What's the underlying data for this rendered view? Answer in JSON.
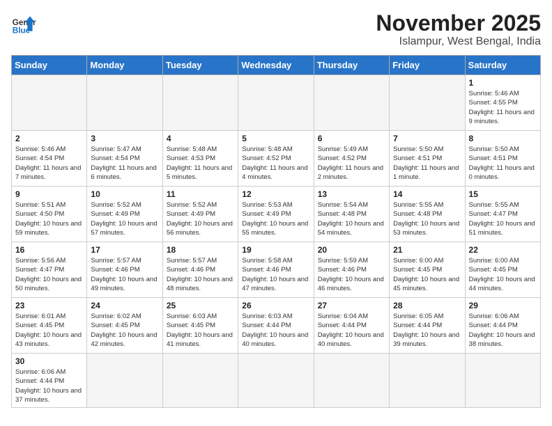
{
  "header": {
    "logo_line1": "General",
    "logo_line2": "Blue",
    "month": "November 2025",
    "location": "Islampur, West Bengal, India"
  },
  "days_of_week": [
    "Sunday",
    "Monday",
    "Tuesday",
    "Wednesday",
    "Thursday",
    "Friday",
    "Saturday"
  ],
  "weeks": [
    [
      {
        "day": "",
        "info": ""
      },
      {
        "day": "",
        "info": ""
      },
      {
        "day": "",
        "info": ""
      },
      {
        "day": "",
        "info": ""
      },
      {
        "day": "",
        "info": ""
      },
      {
        "day": "",
        "info": ""
      },
      {
        "day": "1",
        "info": "Sunrise: 5:46 AM\nSunset: 4:55 PM\nDaylight: 11 hours\nand 9 minutes."
      }
    ],
    [
      {
        "day": "2",
        "info": "Sunrise: 5:46 AM\nSunset: 4:54 PM\nDaylight: 11 hours\nand 7 minutes."
      },
      {
        "day": "3",
        "info": "Sunrise: 5:47 AM\nSunset: 4:54 PM\nDaylight: 11 hours\nand 6 minutes."
      },
      {
        "day": "4",
        "info": "Sunrise: 5:48 AM\nSunset: 4:53 PM\nDaylight: 11 hours\nand 5 minutes."
      },
      {
        "day": "5",
        "info": "Sunrise: 5:48 AM\nSunset: 4:52 PM\nDaylight: 11 hours\nand 4 minutes."
      },
      {
        "day": "6",
        "info": "Sunrise: 5:49 AM\nSunset: 4:52 PM\nDaylight: 11 hours\nand 2 minutes."
      },
      {
        "day": "7",
        "info": "Sunrise: 5:50 AM\nSunset: 4:51 PM\nDaylight: 11 hours\nand 1 minute."
      },
      {
        "day": "8",
        "info": "Sunrise: 5:50 AM\nSunset: 4:51 PM\nDaylight: 11 hours\nand 0 minutes."
      }
    ],
    [
      {
        "day": "9",
        "info": "Sunrise: 5:51 AM\nSunset: 4:50 PM\nDaylight: 10 hours\nand 59 minutes."
      },
      {
        "day": "10",
        "info": "Sunrise: 5:52 AM\nSunset: 4:49 PM\nDaylight: 10 hours\nand 57 minutes."
      },
      {
        "day": "11",
        "info": "Sunrise: 5:52 AM\nSunset: 4:49 PM\nDaylight: 10 hours\nand 56 minutes."
      },
      {
        "day": "12",
        "info": "Sunrise: 5:53 AM\nSunset: 4:49 PM\nDaylight: 10 hours\nand 55 minutes."
      },
      {
        "day": "13",
        "info": "Sunrise: 5:54 AM\nSunset: 4:48 PM\nDaylight: 10 hours\nand 54 minutes."
      },
      {
        "day": "14",
        "info": "Sunrise: 5:55 AM\nSunset: 4:48 PM\nDaylight: 10 hours\nand 53 minutes."
      },
      {
        "day": "15",
        "info": "Sunrise: 5:55 AM\nSunset: 4:47 PM\nDaylight: 10 hours\nand 51 minutes."
      }
    ],
    [
      {
        "day": "16",
        "info": "Sunrise: 5:56 AM\nSunset: 4:47 PM\nDaylight: 10 hours\nand 50 minutes."
      },
      {
        "day": "17",
        "info": "Sunrise: 5:57 AM\nSunset: 4:46 PM\nDaylight: 10 hours\nand 49 minutes."
      },
      {
        "day": "18",
        "info": "Sunrise: 5:57 AM\nSunset: 4:46 PM\nDaylight: 10 hours\nand 48 minutes."
      },
      {
        "day": "19",
        "info": "Sunrise: 5:58 AM\nSunset: 4:46 PM\nDaylight: 10 hours\nand 47 minutes."
      },
      {
        "day": "20",
        "info": "Sunrise: 5:59 AM\nSunset: 4:46 PM\nDaylight: 10 hours\nand 46 minutes."
      },
      {
        "day": "21",
        "info": "Sunrise: 6:00 AM\nSunset: 4:45 PM\nDaylight: 10 hours\nand 45 minutes."
      },
      {
        "day": "22",
        "info": "Sunrise: 6:00 AM\nSunset: 4:45 PM\nDaylight: 10 hours\nand 44 minutes."
      }
    ],
    [
      {
        "day": "23",
        "info": "Sunrise: 6:01 AM\nSunset: 4:45 PM\nDaylight: 10 hours\nand 43 minutes."
      },
      {
        "day": "24",
        "info": "Sunrise: 6:02 AM\nSunset: 4:45 PM\nDaylight: 10 hours\nand 42 minutes."
      },
      {
        "day": "25",
        "info": "Sunrise: 6:03 AM\nSunset: 4:45 PM\nDaylight: 10 hours\nand 41 minutes."
      },
      {
        "day": "26",
        "info": "Sunrise: 6:03 AM\nSunset: 4:44 PM\nDaylight: 10 hours\nand 40 minutes."
      },
      {
        "day": "27",
        "info": "Sunrise: 6:04 AM\nSunset: 4:44 PM\nDaylight: 10 hours\nand 40 minutes."
      },
      {
        "day": "28",
        "info": "Sunrise: 6:05 AM\nSunset: 4:44 PM\nDaylight: 10 hours\nand 39 minutes."
      },
      {
        "day": "29",
        "info": "Sunrise: 6:06 AM\nSunset: 4:44 PM\nDaylight: 10 hours\nand 38 minutes."
      }
    ],
    [
      {
        "day": "30",
        "info": "Sunrise: 6:06 AM\nSunset: 4:44 PM\nDaylight: 10 hours\nand 37 minutes."
      },
      {
        "day": "",
        "info": ""
      },
      {
        "day": "",
        "info": ""
      },
      {
        "day": "",
        "info": ""
      },
      {
        "day": "",
        "info": ""
      },
      {
        "day": "",
        "info": ""
      },
      {
        "day": "",
        "info": ""
      }
    ]
  ]
}
